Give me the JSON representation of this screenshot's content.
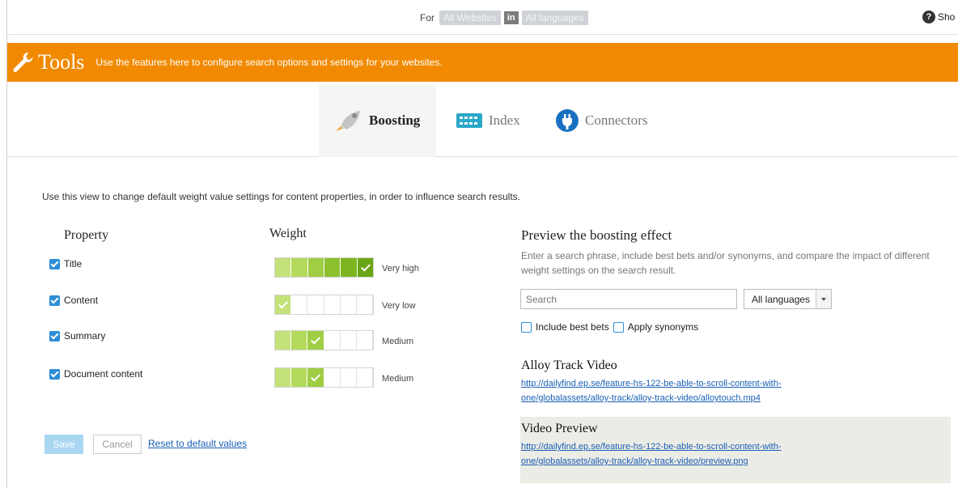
{
  "topbar": {
    "for_label": "For",
    "site_scope": "All Websites",
    "in_label": "in",
    "language_scope": "All languages",
    "help_label": "Sho"
  },
  "banner": {
    "title": "Tools",
    "description": "Use the features here to configure search options and settings for your websites."
  },
  "tabs": [
    {
      "label": "Boosting",
      "icon": "rocket-icon",
      "active": true
    },
    {
      "label": "Index",
      "icon": "index-grid-icon",
      "active": false
    },
    {
      "label": "Connectors",
      "icon": "plug-icon",
      "active": false
    }
  ],
  "intro": "Use this view to change default weight value settings for content properties, in order to influence search results.",
  "boosting": {
    "property_header": "Property",
    "weight_header": "Weight",
    "rows": [
      {
        "property": "Title",
        "checked": true,
        "level": 6,
        "weight_label": "Very high"
      },
      {
        "property": "Content",
        "checked": true,
        "level": 1,
        "weight_label": "Very low"
      },
      {
        "property": "Summary",
        "checked": true,
        "level": 3,
        "weight_label": "Medium"
      },
      {
        "property": "Document content",
        "checked": true,
        "level": 3,
        "weight_label": "Medium"
      }
    ],
    "levels_total": 6,
    "save_label": "Save",
    "cancel_label": "Cancel",
    "reset_label": "Reset to default values"
  },
  "preview": {
    "title": "Preview the boosting effect",
    "description": "Enter a search phrase, include best bets and/or synonyms, and compare the impact of different weight settings on the search result.",
    "search_placeholder": "Search",
    "language": "All languages",
    "include_best_bets_label": "Include best bets",
    "apply_synonyms_label": "Apply synonyms",
    "results": [
      {
        "title": "Alloy Track Video",
        "url_line1": "http://dailyfind.ep.se/feature-hs-122-be-able-to-scroll-content-with-",
        "url_line2": "one/globalassets/alloy-track/alloy-track-video/alloytouch.mp4"
      },
      {
        "title": "Video Preview",
        "url_line1": "http://dailyfind.ep.se/feature-hs-122-be-able-to-scroll-content-with-",
        "url_line2": "one/globalassets/alloy-track/alloy-track-video/preview.png"
      }
    ]
  },
  "colors": {
    "banner": "#f18a00",
    "accent_blue": "#2d8ed6",
    "weight_greens": [
      "#c4e27a",
      "#b3da5b",
      "#9fcd43",
      "#8cc02e",
      "#7cb51f",
      "#6aa614"
    ]
  }
}
